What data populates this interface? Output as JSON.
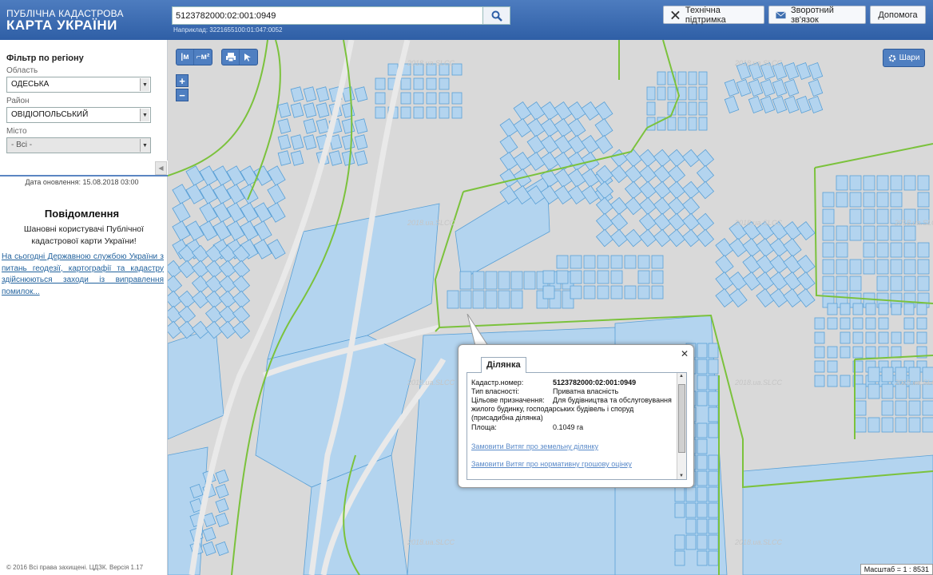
{
  "header": {
    "logo_line1": "ПУБЛІЧНА КАДАСТРОВА",
    "logo_line2": "КАРТА УКРАЇНИ",
    "search_value": "5123782000:02:001:0949",
    "search_example": "Наприклад: 3221655100:01:047:0052",
    "support_label": "Технічна підтримка",
    "feedback_label": "Зворотний зв'язок",
    "help_label": "Допомога"
  },
  "sidebar": {
    "filter_title": "Фільтр по регіону",
    "region_label": "Область",
    "region_value": "ОДЕСЬКА",
    "district_label": "Район",
    "district_value": "ОВІДІОПОЛЬСЬКИЙ",
    "city_label": "Місто",
    "city_value": "- Всі -",
    "updated": "Дата оновлення: 15.08.2018 03:00",
    "news_title": "Повідомлення",
    "news_body": "Шановні користувачі Публічної кадастрової карти України!",
    "news_link": "На сьогодні Державною службою України з питань геодезії, картографії та кадастру здійснюються заходи із виправлення помилок...",
    "copyright": "© 2016 Всі права захищені. ЦДЗК. Версія 1.17"
  },
  "map": {
    "layers_label": "Шари",
    "scale_text": "Масштаб = 1 : 8531",
    "watermark": "2018.ua.SLCC",
    "tools": [
      "М",
      "М²",
      "print-icon",
      "cursor-info-icon"
    ],
    "colors": {
      "background": "#d9d9d9",
      "parcel_fill": "#b3d4ef",
      "parcel_stroke": "#5aa0d6",
      "boundary": "#7bc23c"
    }
  },
  "popup": {
    "tab_label": "Ділянка",
    "rows": [
      {
        "label": "Кадастр.номер:",
        "value": "5123782000:02:001:0949"
      },
      {
        "label": "Тип власності:",
        "value": "Приватна власність"
      },
      {
        "label": "Цільове призначення:",
        "value": "Для будівництва та обслуговування жилого будинку, господарських будівель і споруд (присадибна ділянка)"
      },
      {
        "label": "Площа:",
        "value": "0.1049 га"
      }
    ],
    "link1": "Замовити Витяг про земельну ділянку",
    "link2": "Замовити Витяг про нормативну грошову оцінку"
  }
}
